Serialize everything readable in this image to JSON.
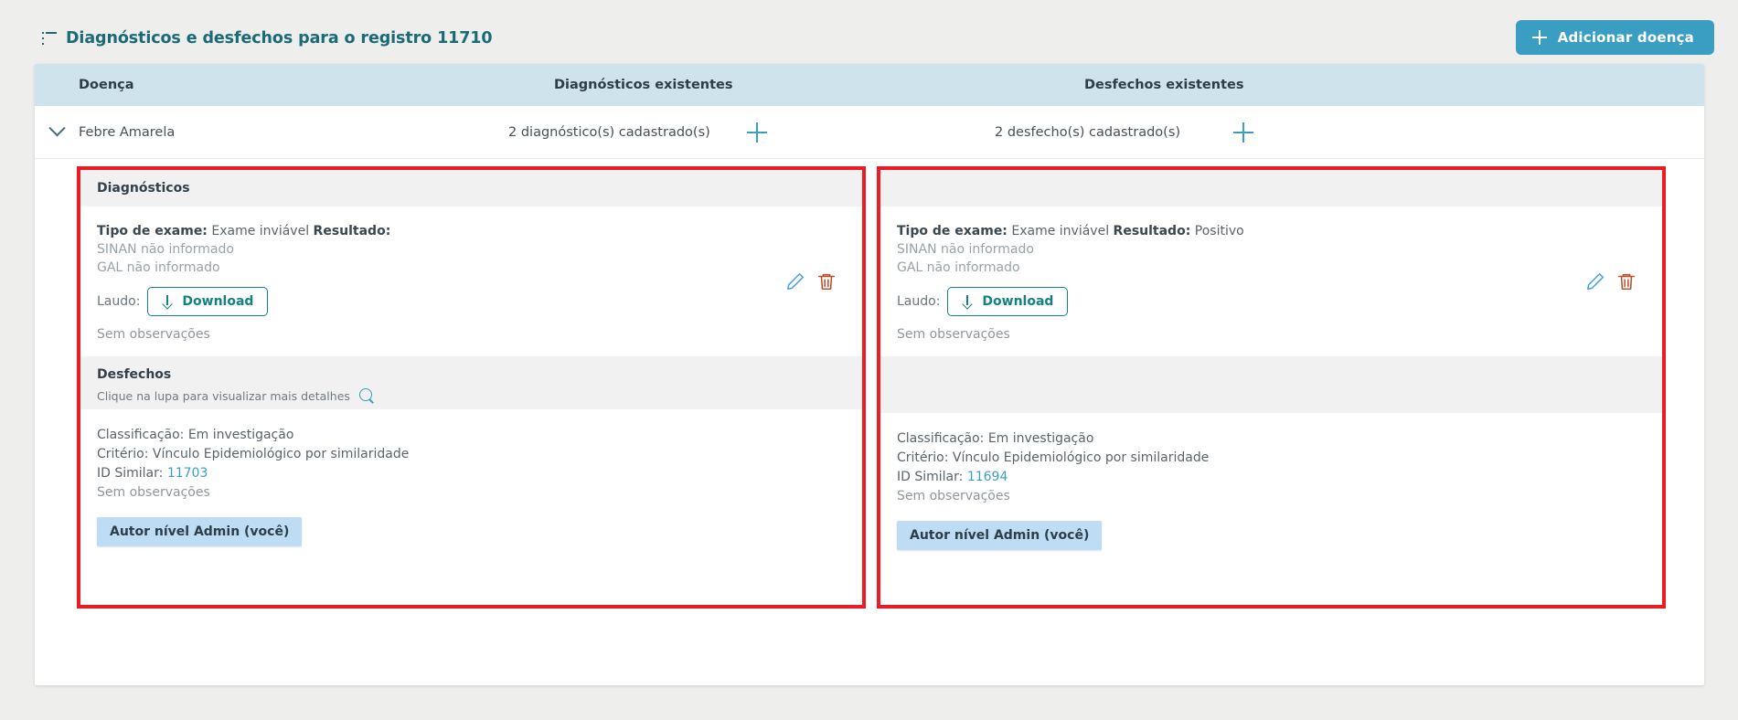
{
  "header": {
    "title": "Diagnósticos e desfechos para o registro 11710",
    "list_icon": "list-icon",
    "add_button": {
      "label": "Adicionar doença",
      "icon": "plus-icon",
      "color": "#3a9ec2"
    }
  },
  "table": {
    "columns": {
      "disease": "Doença",
      "diagnoses": "Diagnósticos existentes",
      "outcomes": "Desfechos existentes"
    },
    "header_bg": "#cfe3ec",
    "rows": [
      {
        "expand_icon": "chevron-down-icon",
        "disease": "Febre Amarela",
        "diagnoses_count": "2 diagnóstico(s) cadastrado(s)",
        "add_diagnosis_icon": "plus-icon",
        "outcomes_count": "2 desfecho(s) cadastrado(s)",
        "add_outcome_icon": "plus-icon"
      }
    ]
  },
  "highlight_color": "#ec1c24",
  "panels": [
    {
      "id": "left",
      "diagnostics": {
        "section_title": "Diagnósticos",
        "entry": {
          "exam_type_label": "Tipo de exame:",
          "exam_type_value": "Exame inviável",
          "result_label": "Resultado:",
          "result_value": "",
          "sinan": "SINAN não informado",
          "gal": "GAL não informado",
          "laudo_label": "Laudo:",
          "download_label": "Download",
          "download_icon": "download-arrow-icon",
          "observations": "Sem observações",
          "edit_icon": "pencil-icon",
          "delete_icon": "trash-icon"
        }
      },
      "outcomes": {
        "section_title": "Desfechos",
        "hint": "Clique na lupa para visualizar mais detalhes",
        "hint_icon": "magnifier-icon",
        "entry": {
          "classification": "Classificação: Em investigação",
          "criterion": "Critério: Vínculo Epidemiológico por similaridade",
          "similar_id_label": "ID Similar:",
          "similar_id_value": "11703",
          "observations": "Sem observações",
          "author_badge": "Autor nível Admin (você)"
        }
      }
    },
    {
      "id": "right",
      "diagnostics": {
        "section_title": "",
        "entry": {
          "exam_type_label": "Tipo de exame:",
          "exam_type_value": "Exame inviável",
          "result_label": "Resultado:",
          "result_value": "Positivo",
          "sinan": "SINAN não informado",
          "gal": "GAL não informado",
          "laudo_label": "Laudo:",
          "download_label": "Download",
          "download_icon": "download-arrow-icon",
          "observations": "Sem observações",
          "edit_icon": "pencil-icon",
          "delete_icon": "trash-icon"
        }
      },
      "outcomes": {
        "section_title": "",
        "hint": "",
        "hint_icon": "",
        "entry": {
          "classification": "Classificação: Em investigação",
          "criterion": "Critério: Vínculo Epidemiológico por similaridade",
          "similar_id_label": "ID Similar:",
          "similar_id_value": "11694",
          "observations": "Sem observações",
          "author_badge": "Autor nível Admin (você)"
        }
      }
    }
  ]
}
